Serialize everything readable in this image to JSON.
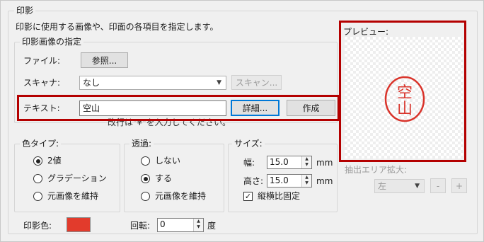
{
  "dialog": {
    "title": "印影",
    "description": "印影に使用する画像や、印面の各項目を指定します。"
  },
  "image_spec": {
    "legend": "印影画像の指定",
    "file_label": "ファイル:",
    "browse_button": "参照...",
    "scanner_label": "スキャナ:",
    "scanner_value": "なし",
    "scan_button": "スキャン...",
    "text_label": "テキスト:",
    "text_value": "空山",
    "details_button": "詳細...",
    "create_button": "作成",
    "hint": "改行は\"¥\"を入力してください。"
  },
  "preview": {
    "label": "プレビュー:",
    "seal_text": "空山",
    "seal_color": "#d9342b"
  },
  "extract": {
    "label": "抽出エリア拡大:",
    "position_value": "左",
    "minus_button": "-",
    "plus_button": "+"
  },
  "color_type": {
    "legend": "色タイプ:",
    "options": [
      "2値",
      "グラデーション",
      "元画像を維持"
    ],
    "selected_index": 0
  },
  "transparency": {
    "legend": "透過:",
    "options": [
      "しない",
      "する",
      "元画像を維持"
    ],
    "selected_index": 1
  },
  "size": {
    "legend": "サイズ:",
    "width_label": "幅:",
    "width_value": "15.0",
    "height_label": "高さ:",
    "height_value": "15.0",
    "unit": "mm",
    "keep_ratio_label": "縦横比固定",
    "keep_ratio_checked": true
  },
  "seal_color": {
    "label": "印影色:",
    "swatch_color": "#e23b2c"
  },
  "rotation": {
    "label": "回転:",
    "value": "0",
    "unit": "度"
  },
  "accent": {
    "highlight": "#b40000",
    "focus": "#0078d7"
  }
}
